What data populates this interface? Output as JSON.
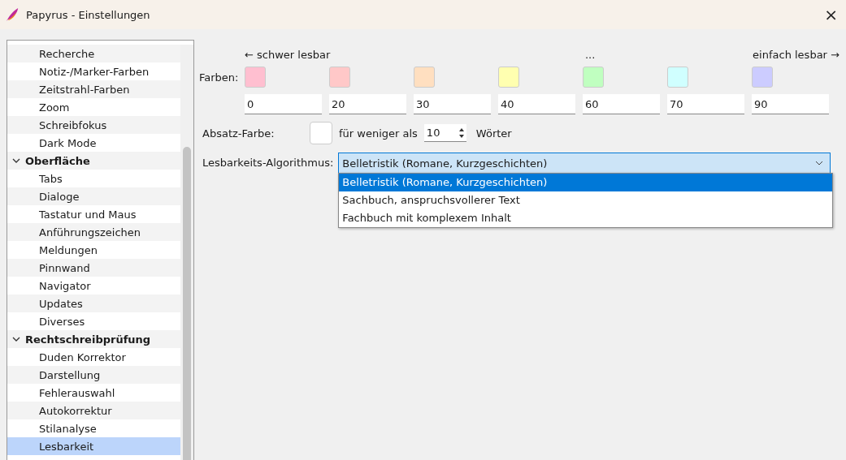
{
  "window": {
    "title": "Papyrus - Einstellungen",
    "close": "×"
  },
  "sidebar": {
    "items": [
      {
        "kind": "leaf",
        "label": "Recherche",
        "selected": false
      },
      {
        "kind": "leaf",
        "label": "Notiz-/Marker-Farben",
        "selected": false
      },
      {
        "kind": "leaf",
        "label": "Zeitstrahl-Farben",
        "selected": false
      },
      {
        "kind": "leaf",
        "label": "Zoom",
        "selected": false
      },
      {
        "kind": "leaf",
        "label": "Schreibfokus",
        "selected": false
      },
      {
        "kind": "leaf",
        "label": "Dark Mode",
        "selected": false
      },
      {
        "kind": "group",
        "label": "Oberfläche",
        "expanded": true,
        "children": [
          {
            "label": "Tabs",
            "selected": false
          },
          {
            "label": "Dialoge",
            "selected": false
          },
          {
            "label": "Tastatur und Maus",
            "selected": false
          },
          {
            "label": "Anführungszeichen",
            "selected": false
          },
          {
            "label": "Meldungen",
            "selected": false
          },
          {
            "label": "Pinnwand",
            "selected": false
          },
          {
            "label": "Navigator",
            "selected": false
          },
          {
            "label": "Updates",
            "selected": false
          },
          {
            "label": "Diverses",
            "selected": false
          }
        ]
      },
      {
        "kind": "group",
        "label": "Rechtschreibprüfung",
        "expanded": true,
        "children": [
          {
            "label": "Duden Korrektor",
            "selected": false
          },
          {
            "label": "Darstellung",
            "selected": false
          },
          {
            "label": "Fehlerauswahl",
            "selected": false
          },
          {
            "label": "Autokorrektur",
            "selected": false
          },
          {
            "label": "Stilanalyse",
            "selected": false
          },
          {
            "label": "Lesbarkeit",
            "selected": true
          }
        ]
      }
    ]
  },
  "scale": {
    "left": "← schwer lesbar",
    "middle": "...",
    "right": "einfach lesbar →"
  },
  "colors": {
    "label": "Farben:",
    "swatches": [
      {
        "color": "#ffbfd0",
        "value": "0"
      },
      {
        "color": "#ffc8c8",
        "value": "20"
      },
      {
        "color": "#ffdfc0",
        "value": "30"
      },
      {
        "color": "#ffffb0",
        "value": "40"
      },
      {
        "color": "#c0ffc0",
        "value": "60"
      },
      {
        "color": "#d0ffff",
        "value": "70"
      },
      {
        "color": "#ccccff",
        "value": "90"
      }
    ]
  },
  "paragraph": {
    "label": "Absatz-Farbe:",
    "color": "#ffffff",
    "prefix": "für weniger als",
    "count": "10",
    "suffix": "Wörter"
  },
  "algorithm": {
    "label": "Lesbarkeits-Algorithmus:",
    "value": "Belletristik (Romane, Kurzgeschichten)",
    "expanded": true,
    "options": [
      {
        "label": "Belletristik (Romane, Kurzgeschichten)",
        "selected": true
      },
      {
        "label": "Sachbuch, anspruchsvollerer Text",
        "selected": false
      },
      {
        "label": "Fachbuch mit komplexem Inhalt",
        "selected": false
      }
    ]
  }
}
